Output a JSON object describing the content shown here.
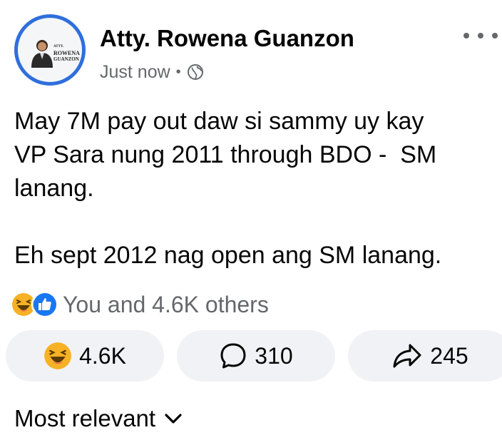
{
  "post": {
    "author": "Atty. Rowena Guanzon",
    "timestamp": "Just now",
    "separator": "•",
    "visibility_icon": "globe-icon",
    "avatar": {
      "line1": "ATTY.",
      "line2": "ROWENA",
      "line3": "GUANZON"
    },
    "text": "May 7M pay out daw si sammy uy kay\nVP Sara nung 2011 through BDO -  SM\nlanang.\n\nEh sept 2012 nag open ang SM lanang.",
    "reactions_summary": "You and 4.6K others",
    "reaction_icons": [
      "haha-icon",
      "like-icon"
    ]
  },
  "actions": {
    "react_count": "4.6K",
    "comment_count": "310",
    "share_count": "245"
  },
  "comments": {
    "sort_label": "Most relevant"
  },
  "colors": {
    "accent": "#1877f2",
    "secondary_text": "#65676b",
    "pill_bg": "#f0f2f5",
    "haha": "#f7b125"
  }
}
